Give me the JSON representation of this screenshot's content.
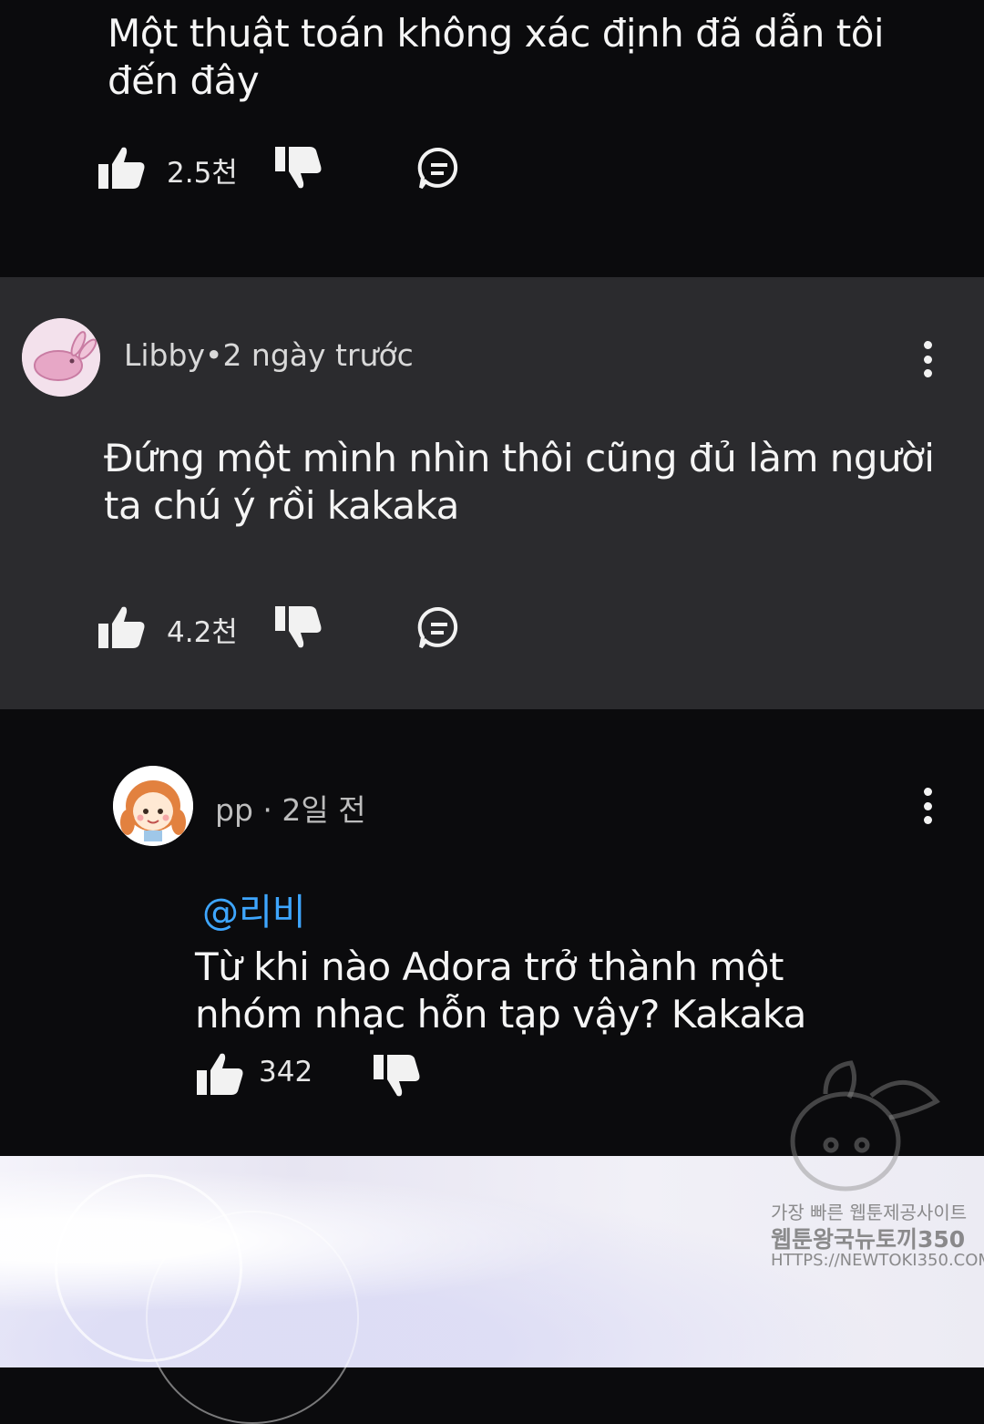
{
  "comments": [
    {
      "text_line1": "Một thuật toán không xác định đã dẫn tôi",
      "text_line2": "đến đây",
      "likes": "2.5천"
    },
    {
      "meta": "Libby•2 ngày trước",
      "text_line1": "Đứng một mình nhìn thôi cũng đủ làm người",
      "text_line2": "ta chú ý rồi kakaka",
      "likes": "4.2천"
    },
    {
      "meta": "pp · 2일 전",
      "mention": "@리비",
      "text_line1": "Từ khi nào Adora trở thành một",
      "text_line2": "nhóm nhạc hỗn tạp vậy? Kakaka",
      "likes": "342"
    }
  ],
  "icons": {
    "like": "thumbs-up-icon",
    "dislike": "thumbs-down-icon",
    "reply": "comment-icon",
    "more": "more-vertical-icon"
  },
  "watermark": {
    "line1": "가장 빠른 웹툰제공사이트",
    "line2": "웹툰왕국뉴토끼350",
    "line3": "HTTPS://NEWTOKI350.COM"
  },
  "colors": {
    "dark_bg": "#0b0b0d",
    "highlight_bg": "#2b2b2e",
    "mention": "#3ea6ff"
  }
}
